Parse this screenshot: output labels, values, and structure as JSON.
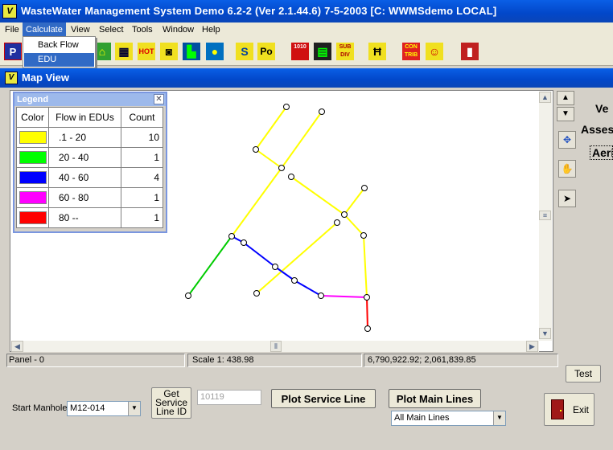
{
  "window": {
    "title": "WasteWater Management System Demo 6.2-2  (Ver 2.1.44.6)   7-5-2003   [C:  WWMSdemo  LOCAL]",
    "app_icon_letter": "V"
  },
  "menu": [
    "File",
    "Calculate",
    "View",
    "Select",
    "Tools",
    "Window",
    "Help"
  ],
  "calculate_menu": {
    "items": [
      "Back Flow",
      "EDU"
    ],
    "selected": "EDU"
  },
  "toolbar": {
    "buttons": [
      {
        "icon": "p-icon",
        "label": "P"
      },
      {
        "icon": "map-houses-icon",
        "label": "⌂"
      },
      {
        "icon": "grid-icon",
        "label": "▦"
      },
      {
        "icon": "hot-icon",
        "label": "HOT"
      },
      {
        "icon": "camera-icon",
        "label": "◙"
      },
      {
        "icon": "building-icon",
        "label": "▙"
      },
      {
        "icon": "lightbulb-icon",
        "label": "●"
      },
      {
        "icon": "s-icon",
        "label": "S"
      },
      {
        "icon": "po-icon",
        "label": "Po"
      },
      {
        "icon": "binary-icon",
        "label": "1010"
      },
      {
        "icon": "panel-icon",
        "label": "▤"
      },
      {
        "icon": "subdiv-icon",
        "label": "SUB DIV"
      },
      {
        "icon": "manhole-icon",
        "label": "Ħ"
      },
      {
        "icon": "contrib-icon",
        "label": "CON TRIB"
      },
      {
        "icon": "person-icon",
        "label": "☺"
      },
      {
        "icon": "exit-door-icon",
        "label": "▮"
      }
    ]
  },
  "map_view": {
    "title": "Map View",
    "app_icon_letter": "V"
  },
  "legend": {
    "title": "Legend",
    "headers": [
      "Color",
      "Flow in EDUs",
      "Count"
    ],
    "rows": [
      {
        "color": "#ffff00",
        "range": ".1 - 20",
        "count": "10"
      },
      {
        "color": "#00ff00",
        "range": "20 - 40",
        "count": "1"
      },
      {
        "color": "#0000ff",
        "range": "40 - 60",
        "count": "4"
      },
      {
        "color": "#ff00ff",
        "range": "60 - 80",
        "count": "1"
      },
      {
        "color": "#ff0000",
        "range": "80 --",
        "count": "1"
      }
    ]
  },
  "side_labels": {
    "ve": "Ve",
    "asses": "Asses",
    "aeri": "Aeri"
  },
  "status": {
    "panel": "Panel - 0",
    "scale": "Scale 1: 438.98",
    "coords": "6,790,922.92; 2,061,839.85"
  },
  "controls": {
    "test_label": "Test",
    "start_manhole_label": "Start Manhole",
    "start_manhole_value": "M12-014",
    "get_service_label_1": "Get",
    "get_service_label_2": "Service",
    "get_service_label_3": "Line ID",
    "service_id_value": "10119",
    "plot_service_line_label": "Plot Service Line",
    "plot_main_lines_label": "Plot Main Lines",
    "main_lines_option": "All Main Lines",
    "exit_label": "Exit"
  }
}
